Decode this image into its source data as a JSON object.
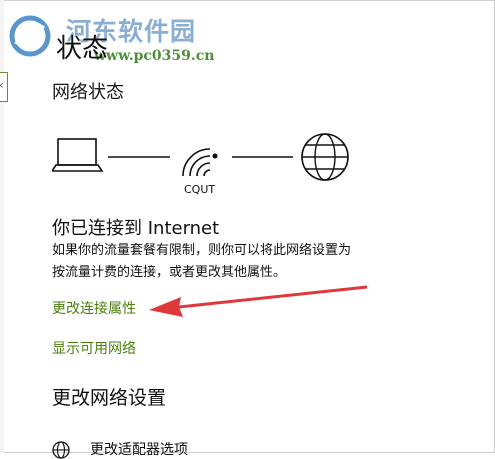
{
  "watermark": {
    "title": "河东软件园",
    "url": "www.pc0359.cn"
  },
  "page": {
    "title": "状态",
    "section_title": "网络状态"
  },
  "network": {
    "ssid": "CQUT",
    "status_heading": "你已连接到 Internet",
    "status_description": "如果你的流量套餐有限制，则你可以将此网络设置为按流量计费的连接，或者更改其他属性。"
  },
  "links": {
    "change_properties": "更改连接属性",
    "show_networks": "显示可用网络"
  },
  "change_settings": {
    "heading": "更改网络设置",
    "adapter_options": "更改适配器选项"
  },
  "colors": {
    "link": "#4a7f0f",
    "arrow": "#e0383a",
    "watermark_blue": "#7fa7cf",
    "watermark_green": "#4f8f3a"
  },
  "icons": {
    "laptop": "laptop-icon",
    "wifi": "wifi-icon",
    "globe": "globe-icon"
  }
}
